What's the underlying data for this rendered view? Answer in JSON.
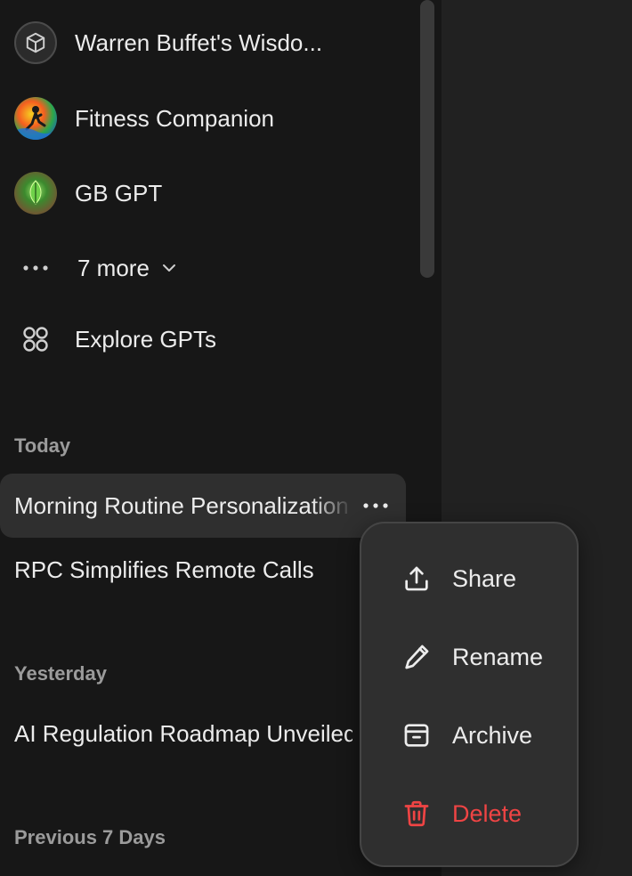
{
  "gpts": [
    {
      "label": "Warren Buffet's Wisdo...",
      "icon": "cube-icon"
    },
    {
      "label": "Fitness Companion",
      "icon": "fitness-avatar"
    },
    {
      "label": "GB GPT",
      "icon": "leaf-avatar"
    }
  ],
  "more": {
    "label": "7 more",
    "icon": "more-dots-icon"
  },
  "explore": {
    "label": "Explore GPTs",
    "icon": "grid-icon"
  },
  "sections": {
    "today": "Today",
    "yesterday": "Yesterday",
    "previous7": "Previous 7 Days"
  },
  "chats": {
    "today": [
      "Morning Routine Personalization",
      "RPC Simplifies Remote Calls"
    ],
    "yesterday": [
      "AI Regulation Roadmap Unveiled"
    ]
  },
  "context_menu": {
    "items": [
      {
        "label": "Share",
        "icon": "share-upload-icon"
      },
      {
        "label": "Rename",
        "icon": "pencil-icon"
      },
      {
        "label": "Archive",
        "icon": "archive-box-icon"
      },
      {
        "label": "Delete",
        "icon": "trash-icon"
      }
    ]
  },
  "colors": {
    "sidebar_bg": "#171717",
    "main_bg": "#212121",
    "menu_bg": "#2f2f2f",
    "danger": "#ef4444",
    "text": "#ececec",
    "muted": "#9b9b9b"
  }
}
